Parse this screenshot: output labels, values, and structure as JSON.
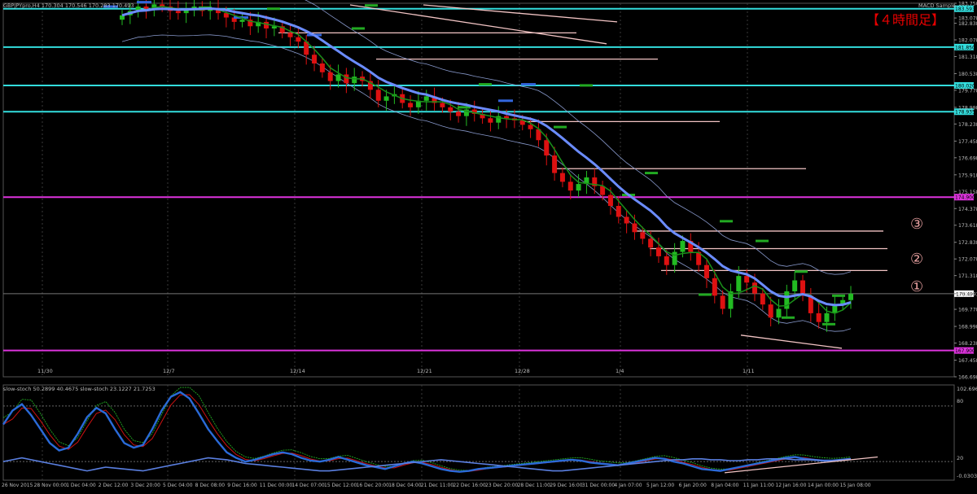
{
  "header": {
    "symbol_line": "GBPJPYpro,H4  170.304 170.546 170.283 170.493",
    "indicator_name": "MACD Sample",
    "timeframe_label": "【４時間足】"
  },
  "colors": {
    "background": "#000000",
    "grid": "#3a3a3a",
    "bull": "#22bb22",
    "bear": "#dd1111",
    "ma_fast": "#1a8f1a",
    "ma_slow": "#6b8cff",
    "bands": "#8899cc",
    "cyan_level": "#33dddd",
    "magenta_level": "#dd33dd",
    "pink_line": "#f2c4c4",
    "blue_marker": "#3366dd",
    "green_marker": "#22aa22",
    "stoch_main": "#2a6ad8",
    "stoch_signal": "#cc1111",
    "stoch_fast_main": "#22aa22",
    "stoch_fast_signal": "#cc1111",
    "text": "#bbbbbb",
    "label_red": "#e80000",
    "circle_label": "#e8a0a0"
  },
  "subpanel": {
    "label": "slow-stoch 50.2899 40.4675  slow-stoch 23.1227 21.7253",
    "top_value": "102.6962",
    "level_80": "80",
    "level_20": "20",
    "bottom_value": "-0.0303"
  },
  "annotations": {
    "circle_1": "①",
    "circle_2": "②",
    "circle_3": "③"
  },
  "chart_data": [
    {
      "type": "candlestick",
      "title": "GBPJPYpro,H4",
      "ylim": [
        166.698,
        183.75
      ],
      "y_ticks": [
        "183.750",
        "183.078",
        "182.838",
        "182.078",
        "181.318",
        "180.538",
        "179.778",
        "178.998",
        "178.238",
        "177.458",
        "176.698",
        "175.918",
        "175.158",
        "174.378",
        "173.618",
        "172.838",
        "172.078",
        "171.318",
        "170.493",
        "169.778",
        "168.998",
        "168.238",
        "167.458",
        "166.698"
      ],
      "x_week_labels": [
        "11/30",
        "12/7",
        "12/14",
        "12/21",
        "12/28",
        "1/4",
        "1/11"
      ],
      "horizontal_levels": [
        {
          "value": 183.5,
          "color": "cyan",
          "label": "183.593"
        },
        {
          "value": 181.75,
          "color": "cyan",
          "label": "181.850"
        },
        {
          "value": 180.0,
          "color": "cyan",
          "label": "180.020"
        },
        {
          "value": 178.8,
          "color": "cyan",
          "label": "178.935"
        },
        {
          "value": 174.9,
          "color": "magenta",
          "label": "174.900"
        },
        {
          "value": 167.9,
          "color": "magenta",
          "label": "167.900"
        }
      ],
      "current_price": 170.493,
      "ohlc_closes": [
        183.2,
        183.4,
        183.6,
        183.5,
        183.7,
        183.6,
        183.4,
        183.3,
        183.5,
        183.6,
        183.4,
        183.5,
        183.3,
        183.1,
        182.9,
        183.0,
        182.7,
        182.9,
        182.6,
        182.7,
        182.4,
        182.2,
        182.0,
        181.4,
        181.0,
        180.6,
        180.2,
        180.5,
        180.1,
        180.4,
        180.2,
        179.8,
        179.3,
        179.5,
        179.6,
        179.2,
        179.0,
        179.3,
        179.5,
        179.2,
        179.0,
        178.8,
        178.6,
        178.9,
        178.7,
        178.5,
        178.3,
        178.6,
        178.5,
        178.4,
        178.2,
        178.0,
        177.5,
        176.8,
        176.0,
        175.6,
        175.2,
        175.5,
        175.8,
        175.4,
        175.0,
        174.5,
        174.0,
        173.7,
        173.3,
        173.0,
        172.6,
        172.2,
        171.8,
        172.4,
        172.9,
        172.4,
        171.8,
        171.2,
        170.4,
        169.8,
        170.6,
        171.3,
        171.0,
        170.5,
        170.0,
        169.4,
        169.8,
        170.6,
        171.1,
        170.4,
        169.6,
        169.2,
        169.6,
        170.0,
        170.2,
        170.493
      ],
      "x_time_labels": [
        "26 Nov 2015",
        "28 Nov 00:00",
        "1 Dec 04:00",
        "2 Dec 12:00",
        "3 Dec 20:00",
        "5 Dec 04:00",
        "8 Dec 08:00",
        "9 Dec 16:00",
        "11 Dec 00:00",
        "14 Dec 07:00",
        "15 Dec 12:00",
        "16 Dec 20:00",
        "18 Dec 04:00",
        "21 Dec 11:00",
        "22 Dec 16:00",
        "23 Dec 20:00",
        "28 Dec 11:00",
        "29 Dec 16:00",
        "31 Dec 00:00",
        "4 Jan 07:00",
        "5 Jan 12:00",
        "6 Jan 20:00",
        "8 Jan 04:00",
        "11 Jan 11:00",
        "12 Jan 16:00",
        "14 Jan 00:00",
        "15 Jan 08:00"
      ]
    },
    {
      "type": "line",
      "title": "slow-stoch",
      "ylim": [
        -0.0303,
        102.6962
      ],
      "levels": [
        80,
        20
      ],
      "series": [
        {
          "name": "slow-stoch 50.2899",
          "values": [
            60,
            75,
            82,
            70,
            55,
            40,
            32,
            35,
            50,
            68,
            78,
            72,
            55,
            40,
            35,
            38,
            55,
            75,
            90,
            95,
            88,
            72,
            55,
            42,
            30,
            24,
            20,
            22,
            25,
            28,
            30,
            28,
            24,
            21,
            20,
            22,
            25,
            22,
            19,
            16,
            14,
            12,
            15,
            18,
            20,
            18,
            15,
            12,
            10,
            9,
            10,
            12,
            13,
            14,
            15,
            16,
            17,
            18,
            19,
            20,
            21,
            22,
            21,
            19,
            18,
            17,
            16,
            18,
            20,
            22,
            24,
            23,
            20,
            18,
            15,
            12,
            11,
            10,
            12,
            14,
            16,
            18,
            20,
            22,
            24,
            25,
            23,
            22,
            21,
            21,
            22,
            23
          ]
        },
        {
          "name": "slow-stoch 23.1227",
          "values": [
            20,
            22,
            24,
            22,
            20,
            18,
            16,
            14,
            12,
            10,
            12,
            14,
            13,
            12,
            11,
            10,
            12,
            14,
            16,
            18,
            20,
            22,
            24,
            23,
            22,
            20,
            18,
            17,
            16,
            15,
            14,
            13,
            12,
            11,
            10,
            10,
            11,
            12,
            13,
            14,
            15,
            16,
            17,
            18,
            19,
            20,
            21,
            22,
            21,
            20,
            19,
            18,
            17,
            16,
            15,
            14,
            13,
            12,
            11,
            10,
            10,
            11,
            12,
            13,
            14,
            15,
            16,
            17,
            18,
            19,
            20,
            21,
            22,
            22,
            23,
            23,
            22,
            22,
            21,
            21,
            22,
            22,
            23,
            23,
            23,
            22,
            22,
            22,
            21,
            21,
            22,
            23
          ]
        }
      ]
    }
  ]
}
